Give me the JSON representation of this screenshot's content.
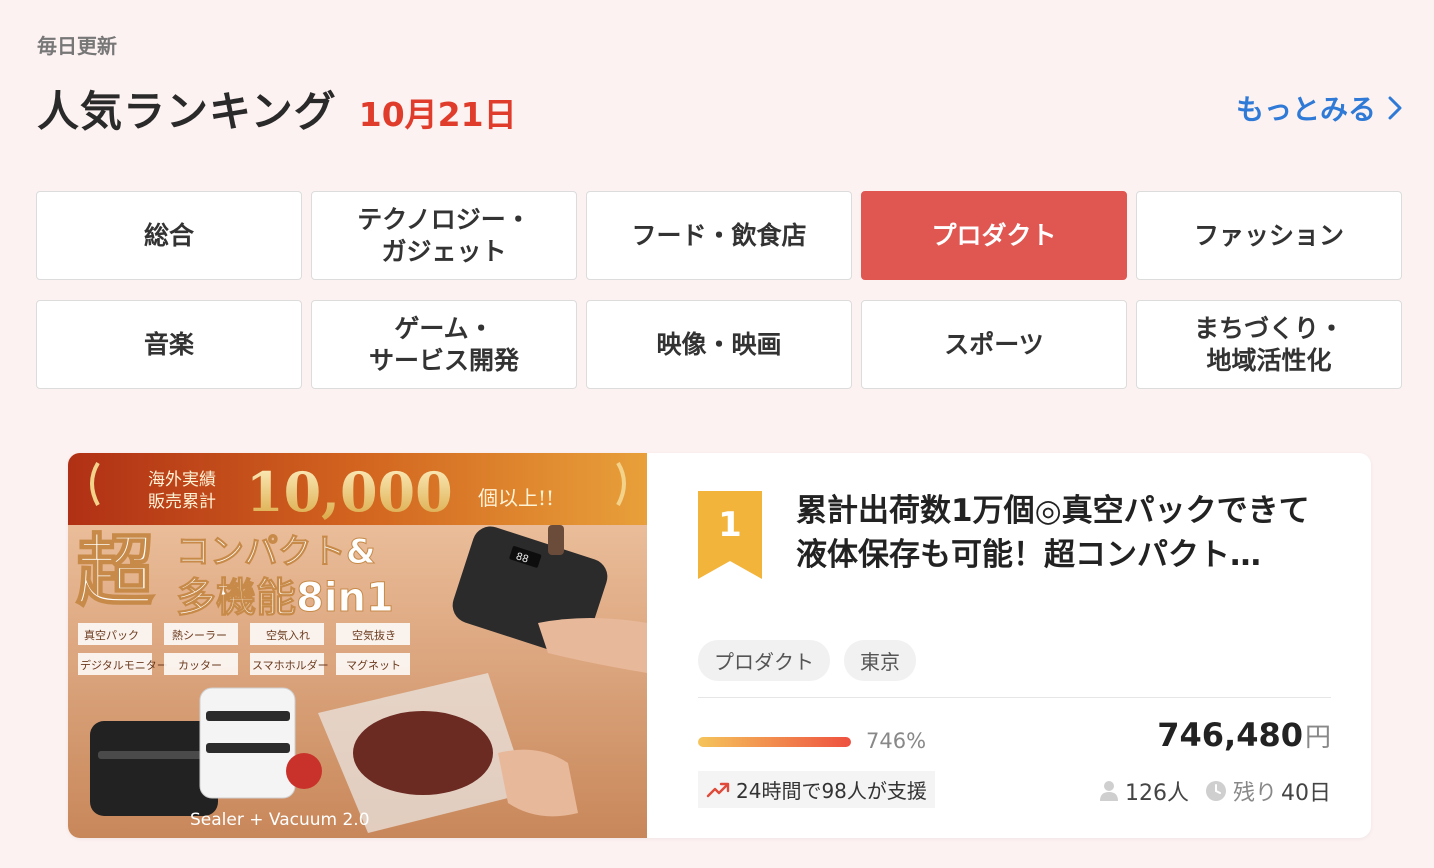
{
  "header": {
    "subtitle": "毎日更新",
    "title": "人気ランキング",
    "date": "10月21日",
    "more_label": "もっとみる"
  },
  "categories": [
    {
      "label": "総合",
      "active": false
    },
    {
      "label": "テクノロジー・\nガジェット",
      "active": false
    },
    {
      "label": "フード・飲食店",
      "active": false
    },
    {
      "label": "プロダクト",
      "active": true
    },
    {
      "label": "ファッション",
      "active": false
    },
    {
      "label": "音楽",
      "active": false
    },
    {
      "label": "ゲーム・\nサービス開発",
      "active": false
    },
    {
      "label": "映像・映画",
      "active": false
    },
    {
      "label": "スポーツ",
      "active": false
    },
    {
      "label": "まちづくり・\n地域活性化",
      "active": false
    }
  ],
  "project": {
    "rank": "1",
    "title": "累計出荷数1万個◎真空パックできて液体保存も可能！超コンパクト…",
    "tags": [
      "プロダクト",
      "東京"
    ],
    "progress_fraction": 1.0,
    "percent": "746%",
    "amount": "746,480",
    "currency": "円",
    "supporters_recent": "24時間で98人が支援",
    "backers": "126人",
    "remaining_label": "残り",
    "remaining_value": "40日",
    "image": {
      "badge_top": "海外実績",
      "badge_bottom": "販売累計",
      "big_number": "10,000",
      "big_suffix": "個以上!!",
      "headline_1": "超",
      "headline_2": "コンパクト&",
      "headline_3": "多機能8in1",
      "features": [
        "真空パック",
        "熱シーラー",
        "空気入れ",
        "空気抜き",
        "デジタルモニター",
        "カッター",
        "スマホホルダー",
        "マグネット"
      ],
      "device_display": "88",
      "product_name": "Sealer + Vacuum 2.0"
    }
  },
  "colors": {
    "accent": "#e05651",
    "date_red": "#e03c2b",
    "link_blue": "#2f7ad6",
    "rank_gold": "#f2b43a"
  }
}
